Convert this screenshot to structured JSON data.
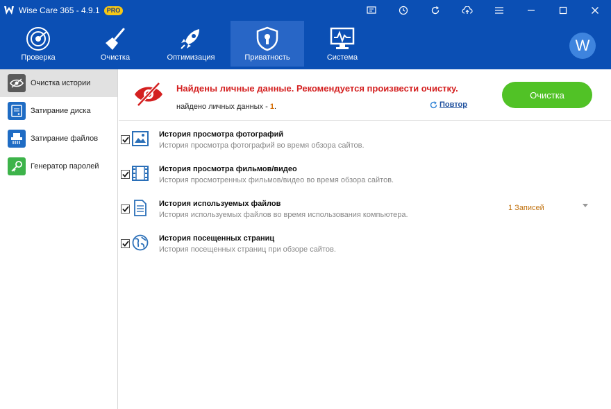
{
  "window": {
    "title": "Wise Care 365 - 4.9.1",
    "badge": "PRO"
  },
  "nav": {
    "items": [
      {
        "label": "Проверка",
        "icon": "radar-icon"
      },
      {
        "label": "Очистка",
        "icon": "broom-icon"
      },
      {
        "label": "Оптимизация",
        "icon": "rocket-icon"
      },
      {
        "label": "Приватность",
        "icon": "shield-icon"
      },
      {
        "label": "Система",
        "icon": "monitor-icon"
      }
    ],
    "active": "Приватность",
    "avatar_letter": "W"
  },
  "sidebar": {
    "items": [
      {
        "label": "Очистка истории",
        "icon": "eye-icon",
        "active": true
      },
      {
        "label": "Затирание диска",
        "icon": "disk-icon",
        "active": false
      },
      {
        "label": "Затирание файлов",
        "icon": "shredder-icon",
        "active": false
      },
      {
        "label": "Генератор паролей",
        "icon": "key-icon",
        "active": false
      }
    ]
  },
  "alert": {
    "title": "Найдены личные данные. Рекомендуется произвести очистку.",
    "subtitle_prefix": "найдено личных данных - ",
    "count": "1",
    "subtitle_suffix": ".",
    "retry_label": "Повтор",
    "clean_button": "Очистка"
  },
  "items": [
    {
      "title": "История просмотра фотографий",
      "desc": "История просмотра фотографий во время обзора сайтов.",
      "checked": true,
      "icon": "image-icon"
    },
    {
      "title": "История просмотра фильмов/видео",
      "desc": "История просмотренных фильмов/видео во время обзора сайтов.",
      "checked": true,
      "icon": "film-icon"
    },
    {
      "title": "История используемых файлов",
      "desc": "История используемых файлов во время использования компьютера.",
      "checked": true,
      "icon": "document-icon",
      "records": "1 Записей"
    },
    {
      "title": "История посещенных страниц",
      "desc": "История посещенных страниц при обзоре сайтов.",
      "checked": true,
      "icon": "globe-icon"
    }
  ],
  "colors": {
    "header_blue": "#0b4fb4",
    "active_nav": "#2866c6",
    "alert_red": "#d42020",
    "button_green": "#51c226",
    "records_orange": "#c0700c"
  }
}
